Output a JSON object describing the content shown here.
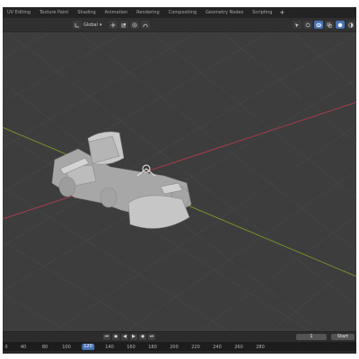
{
  "tabs": [
    "UV Editing",
    "Texture Paint",
    "Shading",
    "Animation",
    "Rendering",
    "Compositing",
    "Geometry Nodes",
    "Scripting"
  ],
  "add_tab_label": "+",
  "header": {
    "orientation": "Global",
    "transform_icons": [
      "move-icon",
      "snap-icon",
      "proportional-icon",
      "falloff-icon"
    ],
    "right_icons": [
      "selectability-icon",
      "gizmo-icon",
      "overlay-icon",
      "xray-icon",
      "shading-solid-icon",
      "shading-material-icon",
      "shading-rendered-icon"
    ]
  },
  "viewport": {
    "object": "go-kart",
    "background_color": "#3d3d3d",
    "grid_color": "#474747",
    "x_axis_color": "#b33c4c",
    "y_axis_color": "#7a9a2a"
  },
  "playbar": {
    "controls": [
      "jump-start-icon",
      "jump-keyframe-back-icon",
      "play-reverse-icon",
      "play-icon",
      "jump-keyframe-forward-icon",
      "jump-end-icon"
    ],
    "current_frame": "1",
    "start_label": "Start"
  },
  "ruler": {
    "ticks": [
      "0",
      "40",
      "80",
      "100",
      "120",
      "140",
      "160",
      "180",
      "200",
      "220",
      "240",
      "260",
      "280"
    ],
    "current": "120"
  }
}
